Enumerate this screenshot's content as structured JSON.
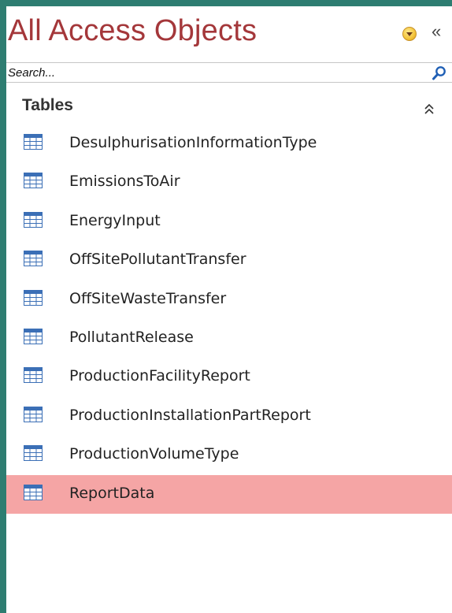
{
  "pane": {
    "title": "All Access Objects",
    "menu_icon": "dropdown-circle-icon",
    "collapse_label": "«"
  },
  "search": {
    "placeholder": "Search...",
    "value": "",
    "icon": "search-icon"
  },
  "group": {
    "title": "Tables",
    "toggle_label": "⌃⌃"
  },
  "tables": [
    {
      "label": "DesulphurisationInformationType",
      "icon": "table-icon",
      "selected": false
    },
    {
      "label": "EmissionsToAir",
      "icon": "table-icon",
      "selected": false
    },
    {
      "label": "EnergyInput",
      "icon": "table-icon",
      "selected": false
    },
    {
      "label": "OffSitePollutantTransfer",
      "icon": "table-icon",
      "selected": false
    },
    {
      "label": "OffSiteWasteTransfer",
      "icon": "table-icon",
      "selected": false
    },
    {
      "label": "PollutantRelease",
      "icon": "table-icon",
      "selected": false
    },
    {
      "label": "ProductionFacilityReport",
      "icon": "table-icon",
      "selected": false
    },
    {
      "label": "ProductionInstallationPartReport",
      "icon": "table-icon",
      "selected": false
    },
    {
      "label": "ProductionVolumeType",
      "icon": "table-icon",
      "selected": false
    },
    {
      "label": "ReportData",
      "icon": "table-icon",
      "selected": true
    }
  ],
  "colors": {
    "title": "#a4373a",
    "selected_row": "#f5a5a5",
    "frame": "#2e7d71",
    "table_icon_header": "#3b6fb6"
  }
}
